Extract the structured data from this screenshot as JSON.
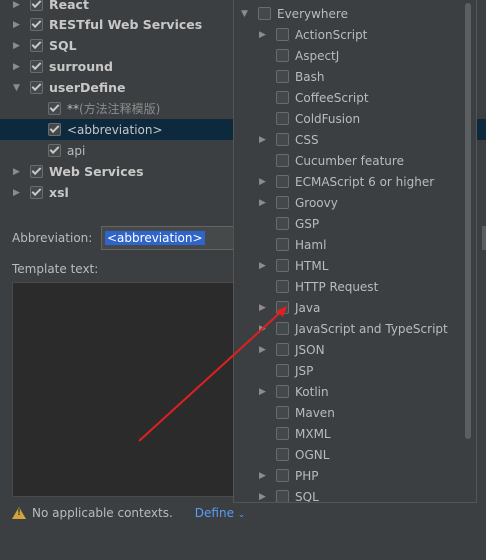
{
  "tree": {
    "items": [
      {
        "label": "React",
        "checked": true,
        "expanded": false
      },
      {
        "label": "RESTful Web Services",
        "checked": true,
        "expanded": false
      },
      {
        "label": "SQL",
        "checked": true,
        "expanded": false
      },
      {
        "label": "surround",
        "checked": true,
        "expanded": false
      },
      {
        "label": "userDefine",
        "checked": true,
        "expanded": true
      },
      {
        "label": "** ",
        "hint": "(方法注释模版)",
        "checked": true
      },
      {
        "label": "<abbreviation>",
        "checked": true,
        "selected": true
      },
      {
        "label": "api",
        "checked": true
      },
      {
        "label": "Web Services",
        "checked": true,
        "expanded": false
      },
      {
        "label": "xsl",
        "checked": true,
        "expanded": false
      }
    ]
  },
  "editor": {
    "abbreviation_label": "Abbreviation:",
    "abbreviation_value": "<abbreviation>",
    "template_label": "Template text:",
    "template_value": ""
  },
  "footer": {
    "warning_text": "No applicable contexts.",
    "define_label": "Define"
  },
  "contexts": {
    "root": "Everywhere",
    "items": [
      {
        "label": "ActionScript",
        "has_children": true
      },
      {
        "label": "AspectJ",
        "has_children": false
      },
      {
        "label": "Bash",
        "has_children": false
      },
      {
        "label": "CoffeeScript",
        "has_children": false
      },
      {
        "label": "ColdFusion",
        "has_children": false
      },
      {
        "label": "CSS",
        "has_children": true
      },
      {
        "label": "Cucumber feature",
        "has_children": false
      },
      {
        "label": "ECMAScript 6 or higher",
        "has_children": true
      },
      {
        "label": "Groovy",
        "has_children": true
      },
      {
        "label": "GSP",
        "has_children": false
      },
      {
        "label": "Haml",
        "has_children": false
      },
      {
        "label": "HTML",
        "has_children": true
      },
      {
        "label": "HTTP Request",
        "has_children": false
      },
      {
        "label": "Java",
        "has_children": true
      },
      {
        "label": "JavaScript and TypeScript",
        "has_children": true
      },
      {
        "label": "JSON",
        "has_children": true
      },
      {
        "label": "JSP",
        "has_children": false
      },
      {
        "label": "Kotlin",
        "has_children": true
      },
      {
        "label": "Maven",
        "has_children": false
      },
      {
        "label": "MXML",
        "has_children": false
      },
      {
        "label": "OGNL",
        "has_children": false
      },
      {
        "label": "PHP",
        "has_children": true
      },
      {
        "label": "SQL",
        "has_children": true
      }
    ]
  },
  "colors": {
    "background": "#3c3f41",
    "selection": "#0d293e",
    "link": "#589df6",
    "annotation_arrow": "#e02020"
  }
}
